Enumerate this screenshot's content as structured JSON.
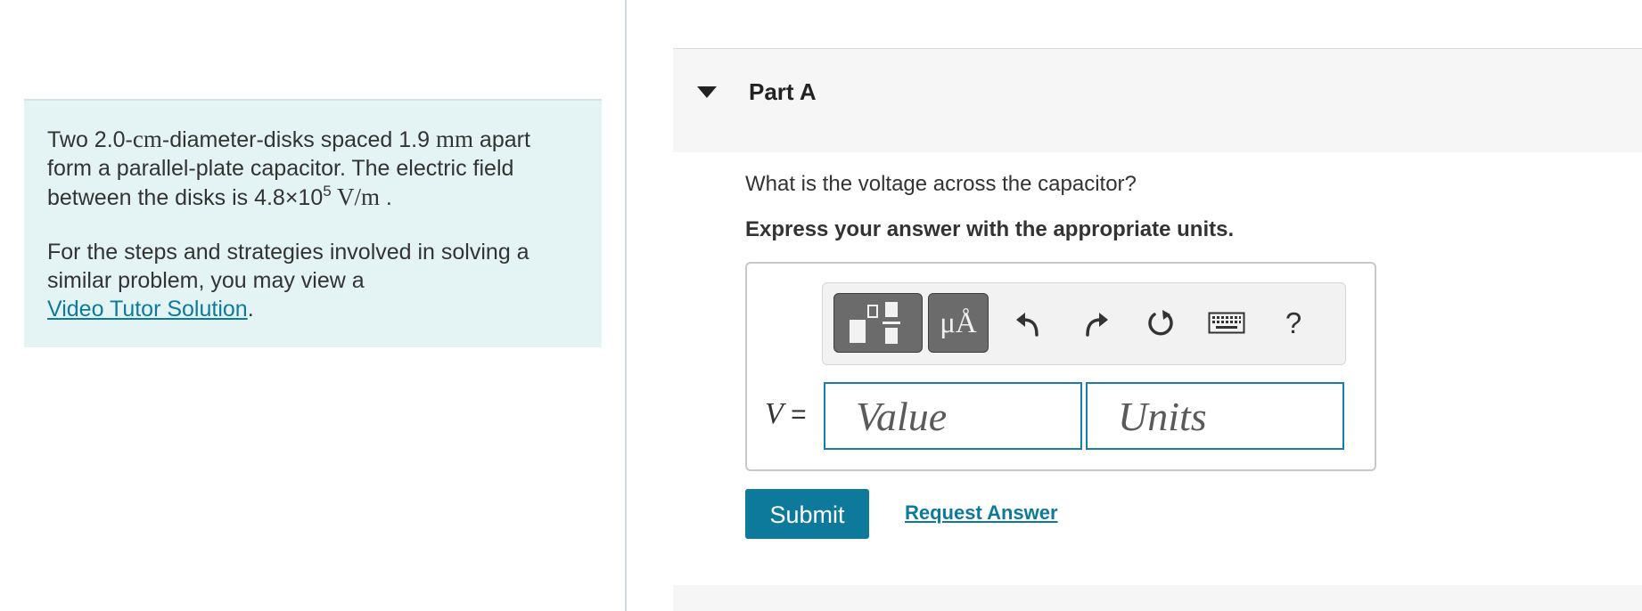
{
  "problem": {
    "line1_a": "Two 2.0-",
    "unit_cm": "cm",
    "line1_b": "-diameter-disks spaced 1.9 ",
    "unit_mm": "mm",
    "line1_c": " apart form a parallel-plate capacitor. The electric field between the disks is 4.8×10",
    "exponent": "5",
    "unit_vm": " V/m",
    "line1_d": " .",
    "help_text": "For the steps and strategies involved in solving a similar problem, you may view a",
    "link_text": "Video Tutor Solution",
    "link_suffix": "."
  },
  "part": {
    "title": "Part A",
    "question": "What is the voltage across the capacitor?",
    "instruction": "Express your answer with the appropriate units."
  },
  "toolbar": {
    "units_label": "μÅ",
    "help_label": "?",
    "icons": [
      "templates-icon",
      "units-icon",
      "undo-icon",
      "redo-icon",
      "reset-icon",
      "keyboard-icon",
      "help-icon"
    ]
  },
  "answer": {
    "variable": "V",
    "equals": " =",
    "value_placeholder": "Value",
    "units_placeholder": "Units",
    "value": "",
    "units": ""
  },
  "actions": {
    "submit_label": "Submit",
    "request_label": "Request Answer"
  },
  "colors": {
    "accent": "#0e7a9b",
    "problem_bg": "#e4f4f4",
    "field_border": "#1a7da8"
  }
}
